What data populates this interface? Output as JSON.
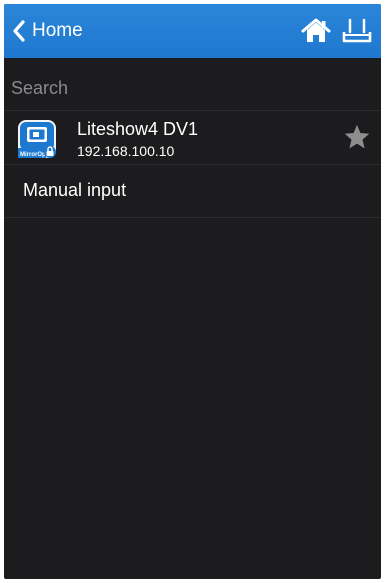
{
  "navbar": {
    "back_label": "Home",
    "icons": [
      "home-icon",
      "router-icon"
    ],
    "color": "#2a86d9"
  },
  "section": {
    "label": "Search"
  },
  "devices": [
    {
      "name": "Liteshow4 DV1",
      "ip": "192.168.100.10",
      "app_icon": "mirrorop-app-icon",
      "app_icon_label": "MirrorOp",
      "locked": true,
      "favorite_icon": "star-icon"
    }
  ],
  "manual": {
    "label": "Manual input"
  },
  "colors": {
    "background": "#1c1c1e",
    "section_text": "#8a8a8e",
    "star": "#8e8e8e"
  }
}
